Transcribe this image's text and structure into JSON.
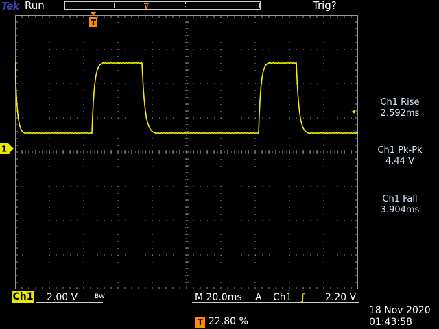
{
  "header": {
    "brand": "Tek",
    "acq_state": "Run",
    "trigger_state": "Trig?",
    "trigger_marker": "T"
  },
  "screen": {
    "channel_marker": "1",
    "trigger_level_marker": "◂"
  },
  "measurements": [
    {
      "label": "Ch1 Rise",
      "value": "2.592ms"
    },
    {
      "label": "Ch1 Pk-Pk",
      "value": "4.44 V"
    },
    {
      "label": "Ch1 Fall",
      "value": "3.904ms"
    }
  ],
  "status": {
    "channel": "Ch1",
    "volts_per_div": "2.00 V",
    "bandwidth": "BW",
    "timebase": "M 20.0ms",
    "trigger_mode": "A",
    "trigger_source": "Ch1",
    "trigger_slope": "∫",
    "trigger_level": "2.20 V",
    "trigger_position_icon": "T",
    "trigger_position": "22.80 %",
    "date": "18 Nov 2020",
    "time": "01:43:58"
  },
  "colors": {
    "trace": "#f0f000",
    "accent_orange": "#ff8a00",
    "graticule": "#9a9a9a"
  }
}
